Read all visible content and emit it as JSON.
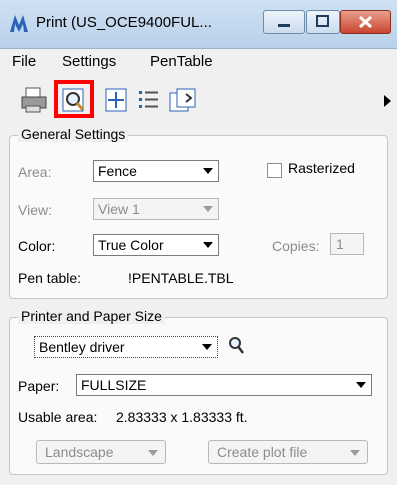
{
  "window": {
    "title": "Print  (US_OCE9400FUL..."
  },
  "menu": {
    "file": "File",
    "settings": "Settings",
    "pentable": "PenTable"
  },
  "toolbar": {
    "icons": [
      "printer-icon",
      "preview-icon",
      "fit-area-icon",
      "list-icon",
      "export-icon"
    ],
    "highlight_color": "#ff0000"
  },
  "general": {
    "title": "General Settings",
    "area_label": "Area:",
    "area_value": "Fence",
    "rasterized_label": "Rasterized",
    "rasterized_checked": false,
    "view_label": "View:",
    "view_value": "View 1",
    "color_label": "Color:",
    "color_value": "True Color",
    "copies_label": "Copies:",
    "copies_value": "1",
    "pentable_label": "Pen table:",
    "pentable_value": "!PENTABLE.TBL"
  },
  "printer": {
    "title": "Printer and Paper Size",
    "driver_value": "Bentley driver",
    "paper_label": "Paper:",
    "paper_value": "FULLSIZE",
    "usable_label": "Usable area:",
    "usable_value": "2.83333 x 1.83333 ft.",
    "orientation_value": "Landscape",
    "plotfile_value": "Create plot file"
  }
}
